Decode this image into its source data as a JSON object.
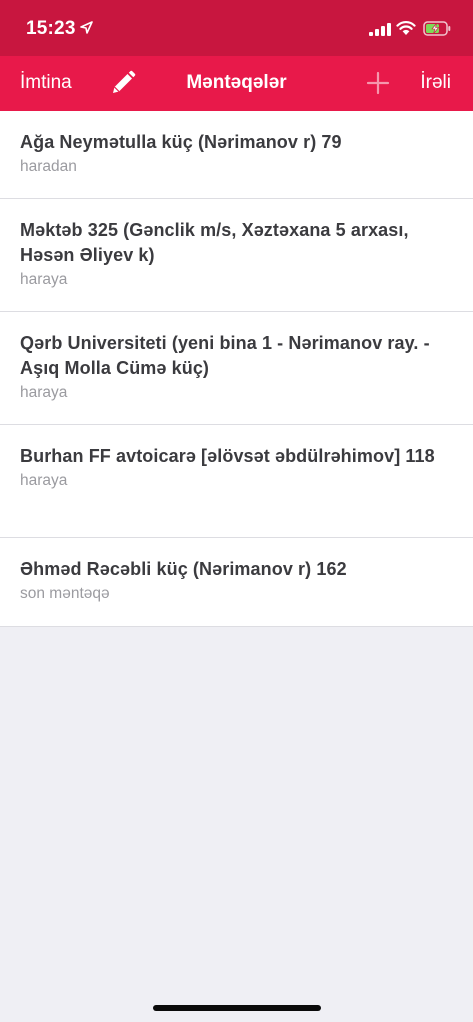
{
  "status_bar": {
    "time": "15:23",
    "location_icon": "location-arrow-icon",
    "signal_icon": "cellular-signal-icon",
    "wifi_icon": "wifi-icon",
    "battery_icon": "battery-charging-icon"
  },
  "nav": {
    "cancel_label": "İmtina",
    "edit_icon": "pencil-icon",
    "title": "Məntəqələr",
    "add_icon": "plus-icon",
    "next_label": "İrəli"
  },
  "colors": {
    "status_bar_bg": "#c8163f",
    "nav_bar_bg": "#e8194a",
    "background": "#efeff4",
    "title_text": "#3b3b3f",
    "subtitle_text": "#9b9ba0"
  },
  "stops": [
    {
      "title": "Ağa Neymətulla küç (Nərimanov r) 79",
      "role": "haradan"
    },
    {
      "title": "Məktəb 325 (Gənclik m/s, Xəztəxana 5 arxası, Həsən Əliyev k)",
      "role": "haraya"
    },
    {
      "title": "Qərb Universiteti (yeni bina 1 - Nərimanov ray. - Aşıq Molla Cümə küç)",
      "role": "haraya"
    },
    {
      "title": "Burhan FF avtoicarə [əlövsət əbdülrəhimov] 118",
      "role": "haraya"
    },
    {
      "title": "Əhməd Rəcəbli küç (Nərimanov r) 162",
      "role": "son məntəqə"
    }
  ]
}
